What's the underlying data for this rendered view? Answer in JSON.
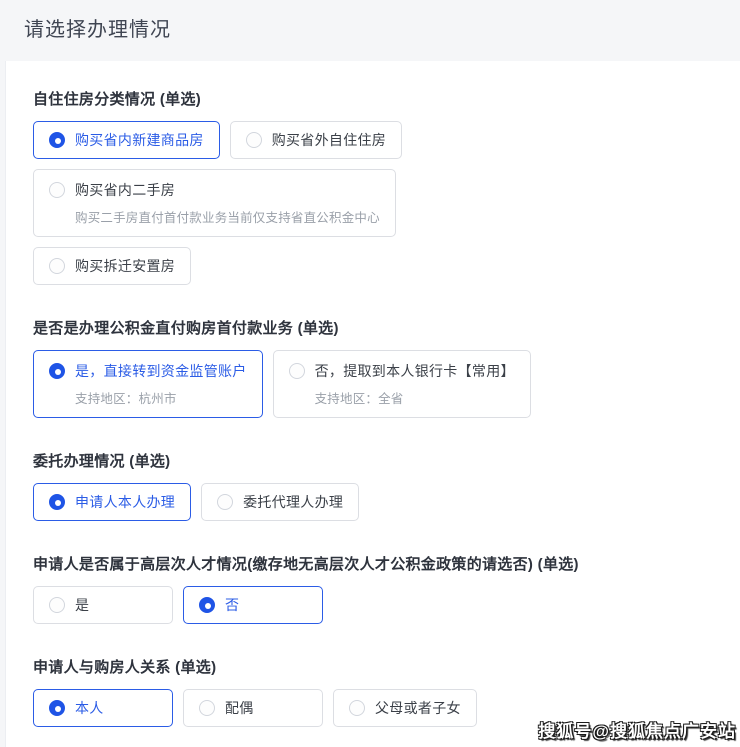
{
  "page": {
    "title": "请选择办理情况"
  },
  "watermark": {
    "text": "搜狐号@搜狐焦点广安站"
  },
  "colors": {
    "accent": "#2b5ce6",
    "page_background": "#f5f6f8",
    "card_background": "#ffffff",
    "unselected_border": "#dcdee3",
    "label_text": "#2e333d",
    "sub_text": "#9aa0a9"
  },
  "sections": [
    {
      "label": "自住住房分类情况 (单选)",
      "options": [
        {
          "label": "购买省内新建商品房",
          "state": "selected"
        },
        {
          "label": "购买省外自住住房",
          "state": "unselected"
        },
        {
          "label": "购买省内二手房",
          "sub": "购买二手房直付首付款业务当前仅支持省直公积金中心",
          "state": "unselected"
        },
        {
          "label": "购买拆迁安置房",
          "state": "unselected"
        }
      ]
    },
    {
      "label": "是否是办理公积金直付购房首付款业务 (单选)",
      "options": [
        {
          "label": "是，直接转到资金监管账户",
          "sub": "支持地区：杭州市",
          "state": "selected"
        },
        {
          "label": "否，提取到本人银行卡【常用】",
          "sub": "支持地区：全省",
          "state": "unselected"
        }
      ]
    },
    {
      "label": "委托办理情况 (单选)",
      "options": [
        {
          "label": "申请人本人办理",
          "state": "selected"
        },
        {
          "label": "委托代理人办理",
          "state": "unselected"
        }
      ]
    },
    {
      "label": "申请人是否属于高层次人才情况(缴存地无高层次人才公积金政策的请选否) (单选)",
      "options": [
        {
          "label": "是",
          "state": "unselected"
        },
        {
          "label": "否",
          "state": "selected"
        }
      ]
    },
    {
      "label": "申请人与购房人关系 (单选)",
      "options": [
        {
          "label": "本人",
          "state": "selected"
        },
        {
          "label": "配偶",
          "state": "unselected"
        },
        {
          "label": "父母或者子女",
          "state": "unselected"
        }
      ]
    }
  ]
}
